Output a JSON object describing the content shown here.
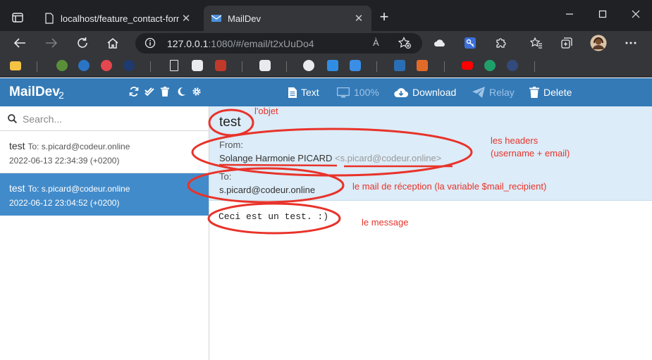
{
  "browser": {
    "tabs": [
      {
        "title": "localhost/feature_contact-form/f",
        "active": false
      },
      {
        "title": "MailDev",
        "active": true
      }
    ],
    "new_tab_label": "+",
    "address": {
      "host": "127.0.0.1",
      "rest": ":1080/#/email/t2xUuDo4"
    },
    "reader_label": "À"
  },
  "app": {
    "name": "MailDev",
    "count": "2",
    "search_placeholder": "Search...",
    "emails": [
      {
        "subject": "test",
        "to": "To: s.picard@codeur.online",
        "date": "2022-06-13 22:34:39 (+0200)",
        "selected": false
      },
      {
        "subject": "test",
        "to": "To: s.picard@codeur.online",
        "date": "2022-06-12 23:04:52 (+0200)",
        "selected": true
      }
    ],
    "toolbar": {
      "text": "Text",
      "zoom": "100%",
      "download": "Download",
      "relay": "Relay",
      "delete": "Delete"
    },
    "message": {
      "subject": "test",
      "from_label": "From:",
      "from_name": "Solange Harmonie PICARD",
      "from_address": "<s.picard@codeur.online>",
      "to_label": "To:",
      "to_address": "s.picard@codeur.online",
      "body": "Ceci est un test. :)"
    }
  },
  "annotations": {
    "subject_note": "l'objet",
    "headers_note_1": "les headers",
    "headers_note_2": "(username + email)",
    "recipient_note": "le mail de réception (la variable $mail_recipient)",
    "message_note": "le message"
  },
  "colors": {
    "accent": "#337ab7",
    "selected": "#428bca",
    "header_bg": "#dcecf8",
    "annotation": "#e8332a"
  }
}
